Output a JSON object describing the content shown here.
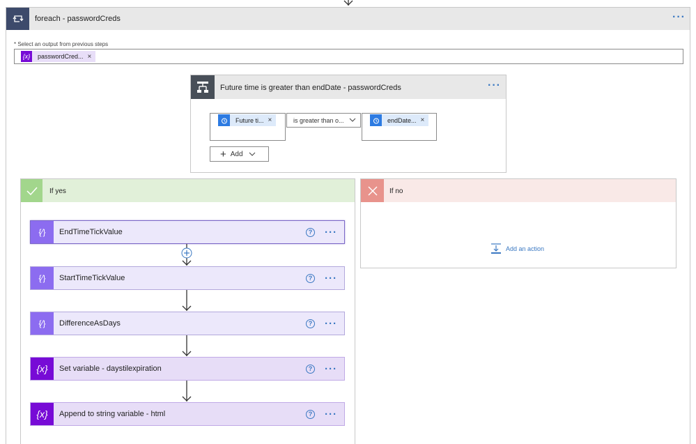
{
  "foreach": {
    "title": "foreach - passwordCreds",
    "output_label": "* Select an output from previous steps",
    "output_token": "passwordCred..."
  },
  "condition": {
    "title": "Future time is greater than endDate - passwordCreds",
    "left_token": "Future ti...",
    "operator": "is greater than o...",
    "right_token": "endDate...",
    "add_label": "Add"
  },
  "if_yes": {
    "title": "If yes",
    "actions": [
      {
        "label": "EndTimeTickValue"
      },
      {
        "label": "StartTimeTickValue"
      },
      {
        "label": "DifferenceAsDays"
      },
      {
        "label": "Set variable - daystilexpiration"
      },
      {
        "label": "Append to string variable - html"
      }
    ]
  },
  "if_no": {
    "title": "If no",
    "add_action": "Add an action"
  },
  "colors": {
    "foreach_header": "#3d4a6b",
    "condition_header": "#484f58",
    "yes_header": "#e1f0d9",
    "yes_icon": "#a2d68c",
    "no_header": "#f9e9e7",
    "no_icon": "#e8938c",
    "compose": "#8c6cf0",
    "variable": "#770bd6",
    "accent": "#3a78c2"
  }
}
